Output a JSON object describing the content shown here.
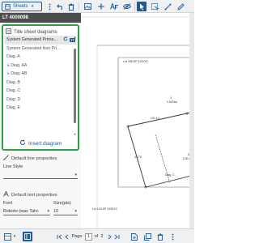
{
  "toolbar": {
    "sheets_label": "Sheets"
  },
  "header": {
    "lt_number": "LT 4000098"
  },
  "diagrams_panel": {
    "title": "Title sheet diagrams",
    "items": [
      {
        "label": "System Generated Prima…",
        "selected": true
      },
      {
        "label": "System Generated Non Primary D…",
        "selected": false
      },
      {
        "label": "Diag. A",
        "selected": false
      },
      {
        "label": "Diag. AA",
        "selected": false,
        "indented": true
      },
      {
        "label": "Diag. AB",
        "selected": false,
        "indented": true
      },
      {
        "label": "Diag. B",
        "selected": false
      },
      {
        "label": "Diag. C",
        "selected": false
      },
      {
        "label": "Diag. D",
        "selected": false
      },
      {
        "label": "Diag. E",
        "selected": false
      }
    ],
    "tt_badge": "TT",
    "insert_label": "Insert diagram"
  },
  "line_props": {
    "title": "Default line properties",
    "style_label": "Line Style",
    "style_value": ""
  },
  "text_props": {
    "title": "Default text properties",
    "font_label": "Font",
    "font_value": "Roboto (was Tahc",
    "size_label": "Size(pts)",
    "size_value": "10"
  },
  "pagination": {
    "page_label": "Page",
    "current_page": "1",
    "of_label": "of",
    "total_pages": "2"
  },
  "canvas": {
    "lot_top_label": "Lot 306 DP 3152XX",
    "lot_bottom_label": "Lot 104 DP 3152XX",
    "parcel_1_label": "1",
    "parcel_1_area": "0.523ha",
    "parcel_2_label": "2",
    "parcel_2_area": "0.513ha",
    "diag_c_label": "Diag. C",
    "dim_label_1": "101.10",
    "dim_label_2": "43.78"
  },
  "colors": {
    "accent": "#1f5a94",
    "panel_border": "#2ea043",
    "header_bg": "#4d4d4d"
  }
}
